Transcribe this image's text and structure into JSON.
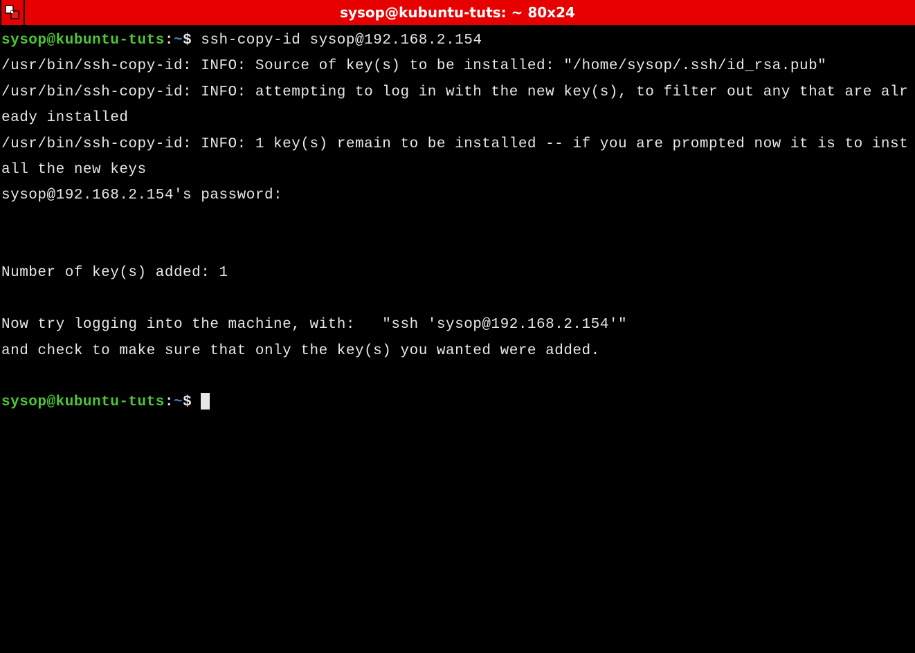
{
  "titlebar": {
    "title": "sysop@kubuntu-tuts: ~ 80x24"
  },
  "prompt1": {
    "user": "sysop@kubuntu-tuts",
    "sep": ":",
    "path": "~",
    "dollar": "$ ",
    "command": "ssh-copy-id sysop@192.168.2.154"
  },
  "output": {
    "line1": "/usr/bin/ssh-copy-id: INFO: Source of key(s) to be installed: \"/home/sysop/.ssh/id_rsa.pub\"",
    "line2": "/usr/bin/ssh-copy-id: INFO: attempting to log in with the new key(s), to filter out any that are already installed",
    "line3": "/usr/bin/ssh-copy-id: INFO: 1 key(s) remain to be installed -- if you are prompted now it is to install the new keys",
    "line4": "sysop@192.168.2.154's password: ",
    "line5": "Number of key(s) added: 1",
    "line6": "Now try logging into the machine, with:   \"ssh 'sysop@192.168.2.154'\"",
    "line7": "and check to make sure that only the key(s) you wanted were added."
  },
  "prompt2": {
    "user": "sysop@kubuntu-tuts",
    "sep": ":",
    "path": "~",
    "dollar": "$ "
  }
}
